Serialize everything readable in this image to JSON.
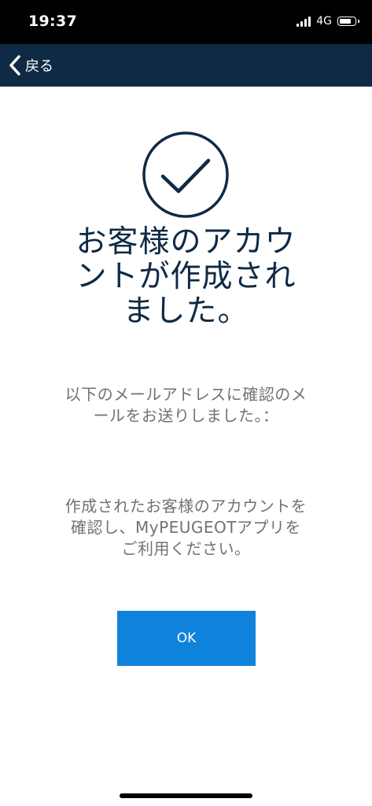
{
  "status_bar": {
    "time": "19:37",
    "network": "4G",
    "icons": [
      "signal-icon",
      "battery-icon"
    ]
  },
  "nav": {
    "back_label": "戻る",
    "back_icon": "chevron-left-icon"
  },
  "main": {
    "icon": "check-circle-icon",
    "title": "お客様のアカウントが作成されました。",
    "message_1": "以下のメールアドレスに確認のメールをお送りしました。：",
    "message_2": "作成されたお客様のアカウントを確認し、MyPEUGEOTアプリをご利用ください。",
    "ok_label": "OK"
  },
  "colors": {
    "nav_background": "#0f2a45",
    "title_color": "#0f2a45",
    "text_gray": "#727272",
    "button_blue": "#0f83db"
  }
}
